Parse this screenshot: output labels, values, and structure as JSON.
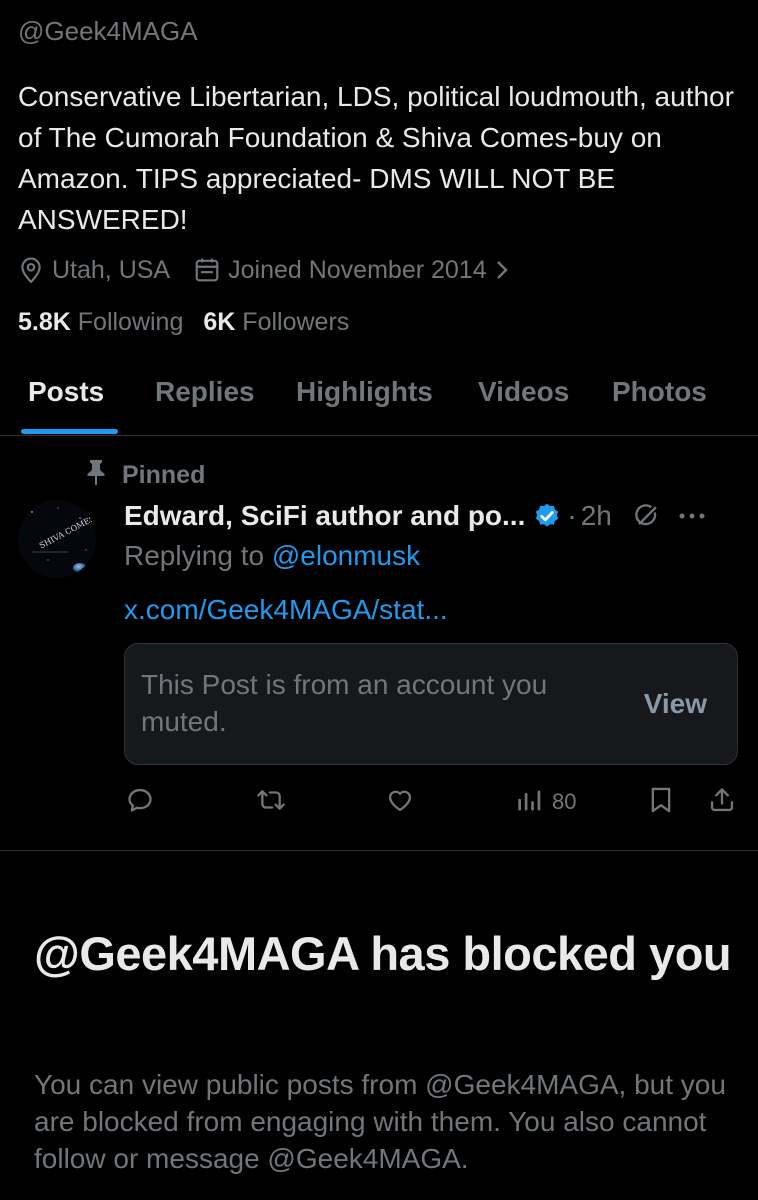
{
  "profile": {
    "handle": "@Geek4MAGA",
    "bio": "Conservative Libertarian, LDS, political loudmouth, author of The Cumorah Foundation & Shiva Comes-buy on Amazon. TIPS appreciated- DMS WILL NOT BE ANSWERED!",
    "location": "Utah, USA",
    "joined": "Joined November 2014",
    "following_count": "5.8K",
    "following_label": "Following",
    "followers_count": "6K",
    "followers_label": "Followers"
  },
  "tabs": [
    {
      "label": "Posts",
      "active": true
    },
    {
      "label": "Replies"
    },
    {
      "label": "Highlights"
    },
    {
      "label": "Videos"
    },
    {
      "label": "Photos"
    }
  ],
  "pinned_post": {
    "pinned_label": "Pinned",
    "author_name": "Edward, SciFi author and po...",
    "separator": "·",
    "time": "2h",
    "avatar_text": "SHIVA COMES",
    "replying_prefix": "Replying to",
    "replying_to": "@elonmusk",
    "link": "x.com/Geek4MAGA/stat...",
    "muted_notice": "This Post is from an account you muted.",
    "view_label": "View",
    "views": "80"
  },
  "blocked": {
    "title": "@Geek4MAGA has blocked you",
    "message": "You can view public posts from @Geek4MAGA, but you are blocked from engaging with them. You also cannot follow or message @Geek4MAGA."
  },
  "colors": {
    "background": "#000000",
    "accent": "#1d9bf0",
    "text_primary": "#e7e9ea",
    "text_secondary": "#71767b",
    "card_background": "#16181c",
    "divider": "#2f3336"
  },
  "icons": [
    "location-pin-icon",
    "calendar-icon",
    "chevron-right-icon",
    "pin-icon",
    "verified-badge-icon",
    "grok-icon",
    "more-icon",
    "reply-icon",
    "repost-icon",
    "like-icon",
    "views-icon",
    "bookmark-icon",
    "share-icon"
  ]
}
